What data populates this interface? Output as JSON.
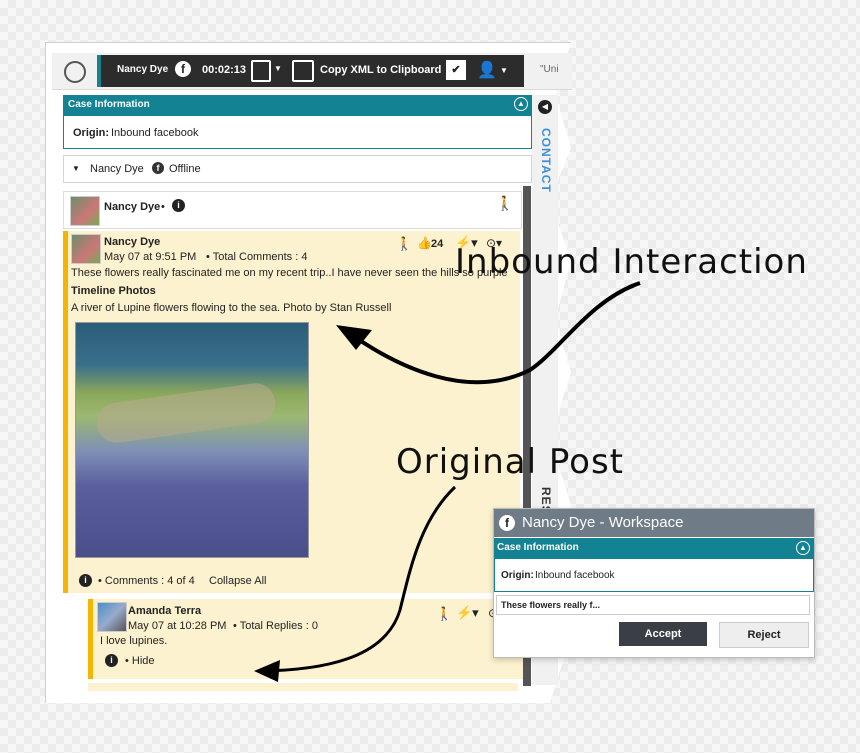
{
  "toolbar": {
    "contact_name": "Nancy Dye",
    "timer": "00:02:13",
    "copy_xml_label": "Copy XML to Clipboard",
    "next_tab_preview": "\"Uni"
  },
  "case_info": {
    "header": "Case Information",
    "origin_label": "Origin:",
    "origin_value": "Inbound facebook"
  },
  "contact_bar": {
    "name": "Nancy Dye",
    "status": "Offline"
  },
  "profile_row": {
    "name": "Nancy Dye",
    "dot": "•"
  },
  "post": {
    "author": "Nancy Dye",
    "date": "May 07 at 9:51 PM",
    "total_comments": "• Total Comments :  4",
    "likes": "24",
    "text": "These flowers really fascinated me on my recent trip..I have never seen the hills so purple :)",
    "album": "Timeline Photos",
    "caption": "A river of Lupine flowers flowing to the sea. Photo by Stan Russell",
    "comments_count": "• Comments :  4 of 4",
    "collapse": "Collapse All"
  },
  "comment": {
    "author": "Amanda Terra",
    "date": "May 07 at 10:28 PM",
    "total_replies": "• Total Replies :  0",
    "text": "I love lupines.",
    "hide": "• Hide"
  },
  "annotations": {
    "inbound": "Inbound Interaction",
    "original": "Original Post"
  },
  "sidebar": {
    "contact_tab": "CONTACT",
    "res_tab": "RES"
  },
  "workspace_popup": {
    "title": "Nancy Dye - Workspace",
    "case_header": "Case Information",
    "origin_label": "Origin:",
    "origin_value": "Inbound facebook",
    "preview": "These flowers really f...",
    "accept": "Accept",
    "reject": "Reject"
  },
  "colors": {
    "teal": "#138292",
    "post_bg": "#fdf2cf",
    "post_accent": "#f4b400",
    "toolbar_dark": "#2c2c2c"
  }
}
